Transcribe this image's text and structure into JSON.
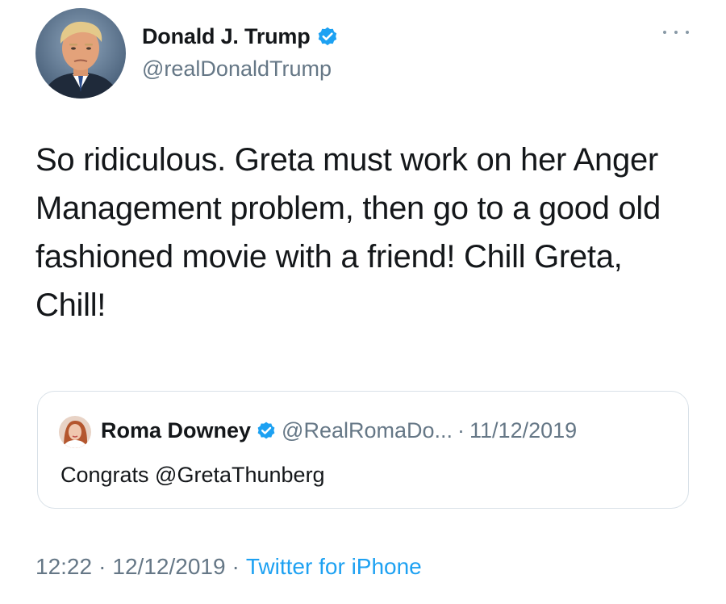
{
  "tweet": {
    "author": {
      "name": "Donald J. Trump",
      "handle": "@realDonaldTrump",
      "verified": true,
      "avatar_icon": "profile-photo"
    },
    "more_icon": "ellipsis-icon",
    "text": "So ridiculous. Greta must work on her Anger Management problem, then go to a good old fashioned movie with a friend! Chill Greta, Chill!",
    "quoted": {
      "name": "Roma Downey",
      "handle": "@RealRomaDo...",
      "separator": "·",
      "date": "11/12/2019",
      "verified": true,
      "text": "Congrats @GretaThunberg"
    },
    "time": "12:22",
    "separator": "·",
    "date": "12/12/2019",
    "source": "Twitter for iPhone"
  },
  "colors": {
    "text": "#14171a",
    "secondary": "#657786",
    "accent": "#1da1f2",
    "border": "#d9e1e8"
  }
}
